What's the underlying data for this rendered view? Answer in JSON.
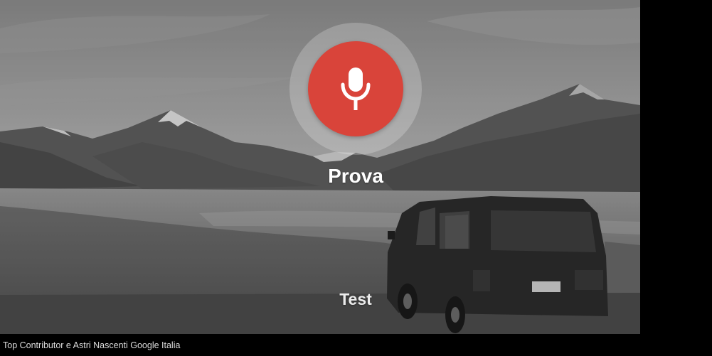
{
  "voice_prompt": {
    "mic_icon": "microphone-icon",
    "prompt_label": "Prova",
    "recognized_text": "Test"
  },
  "footer": {
    "caption": "Top Contributor e Astri Nascenti Google Italia"
  },
  "colors": {
    "mic_button": "#d9443a",
    "mic_halo": "#ffffff",
    "text": "#ffffff",
    "footer_bg": "#000000",
    "footer_text": "#dcdcdc"
  }
}
